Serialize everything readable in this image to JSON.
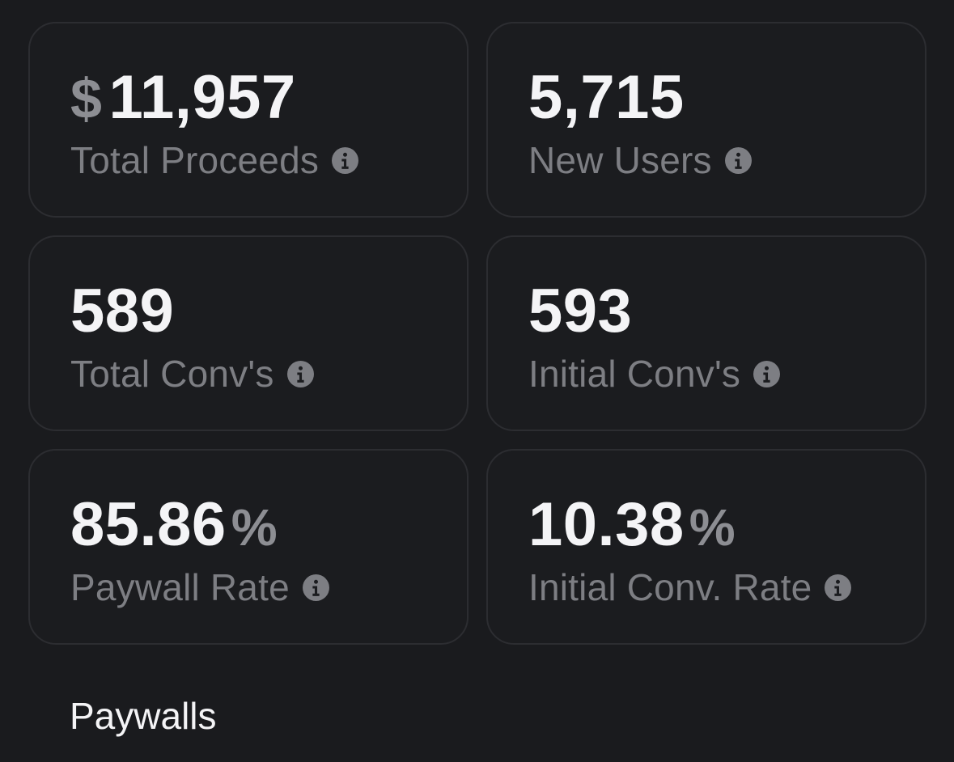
{
  "cards": [
    {
      "prefix": "$",
      "value": "11,957",
      "suffix": "",
      "label": "Total Proceeds",
      "icon": "info-icon"
    },
    {
      "prefix": "",
      "value": "5,715",
      "suffix": "",
      "label": "New Users",
      "icon": "info-icon"
    },
    {
      "prefix": "",
      "value": "589",
      "suffix": "",
      "label": "Total Conv's",
      "icon": "info-icon"
    },
    {
      "prefix": "",
      "value": "593",
      "suffix": "",
      "label": "Initial Conv's",
      "icon": "info-icon"
    },
    {
      "prefix": "",
      "value": "85.86",
      "suffix": "%",
      "label": "Paywall Rate",
      "icon": "info-icon"
    },
    {
      "prefix": "",
      "value": "10.38",
      "suffix": "%",
      "label": "Initial Conv. Rate",
      "icon": "info-icon"
    }
  ],
  "section": {
    "title": "Paywalls"
  },
  "colors": {
    "background": "#1a1b1e",
    "card_border": "#2c2d31",
    "value_text": "#f4f4f6",
    "muted_text": "#7d7e83"
  }
}
